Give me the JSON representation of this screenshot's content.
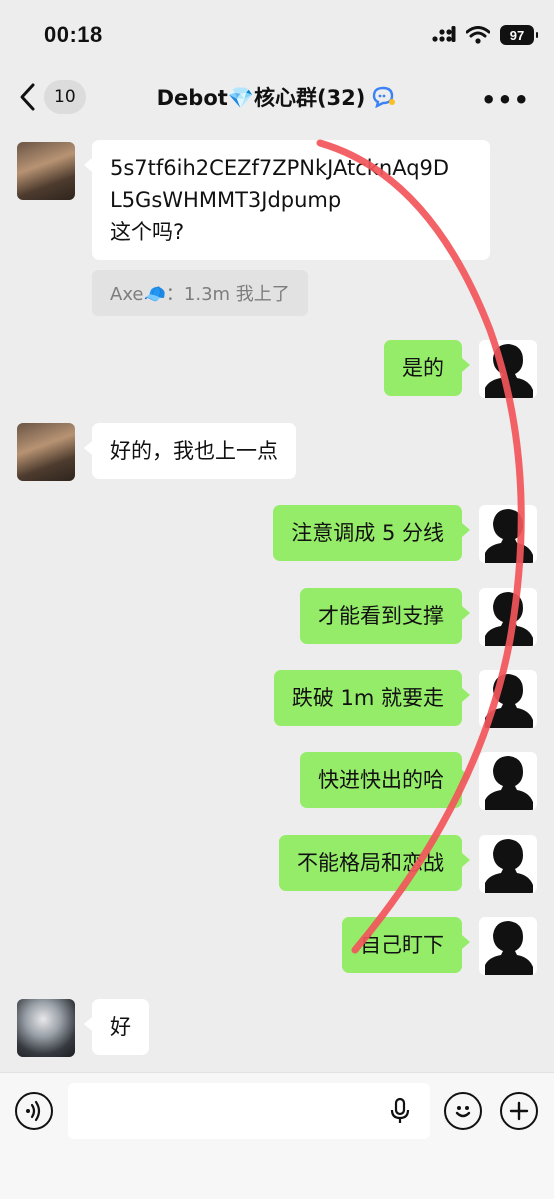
{
  "status_bar": {
    "time": "00:18",
    "battery": "97"
  },
  "nav": {
    "unread_count": "10",
    "title": "Debot💎核心群(32)"
  },
  "messages": [
    {
      "text": "5s7tf6ih2CEZf7ZPNkJAtcknAq9D\nL5GsWHMMT3Jdpump\n这个吗?"
    },
    {
      "quote": "Axe🧢：1.3m 我上了"
    },
    {
      "text": "是的"
    },
    {
      "text": "好的，我也上一点"
    },
    {
      "text": "注意调成 5 分线"
    },
    {
      "text": "才能看到支撑"
    },
    {
      "text": "跌破 1m 就要走"
    },
    {
      "text": "快进快出的哈"
    },
    {
      "text": "不能格局和恋战"
    },
    {
      "text": "自己盯下"
    },
    {
      "text": "好"
    }
  ],
  "colors": {
    "outgoing_bubble": "#95ec69",
    "incoming_bubble": "#ffffff",
    "annotation": "#f2555a"
  },
  "icons": [
    "chevron-left-icon",
    "more-icon",
    "voice-icon",
    "microphone-icon",
    "emoji-icon",
    "plus-icon",
    "signal-icon",
    "wifi-icon",
    "battery-icon",
    "chat-bubble-icon"
  ]
}
